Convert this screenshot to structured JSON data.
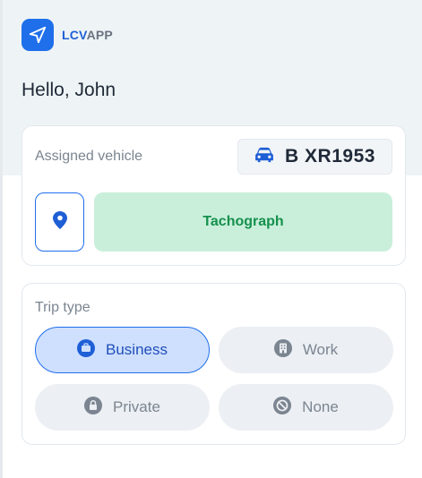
{
  "brand": {
    "name_part1": "LCV",
    "name_part2": "APP",
    "logo_icon": "navigation-arrow-icon"
  },
  "greeting": "Hello, John",
  "vehicle": {
    "label": "Assigned vehicle",
    "plate": "B XR1953",
    "plate_icon": "car-icon",
    "location_icon": "map-pin-icon",
    "tachograph_label": "Tachograph"
  },
  "trip": {
    "label": "Trip type",
    "selected": "Business",
    "options": [
      {
        "label": "Business",
        "icon": "briefcase-icon"
      },
      {
        "label": "Work",
        "icon": "building-icon"
      },
      {
        "label": "Private",
        "icon": "lock-icon"
      },
      {
        "label": "None",
        "icon": "ban-icon"
      }
    ]
  },
  "colors": {
    "accent": "#1f6feb",
    "tachograph_bg": "#c9efdb",
    "tachograph_text": "#15904c",
    "header_bg": "#eef4f5"
  }
}
